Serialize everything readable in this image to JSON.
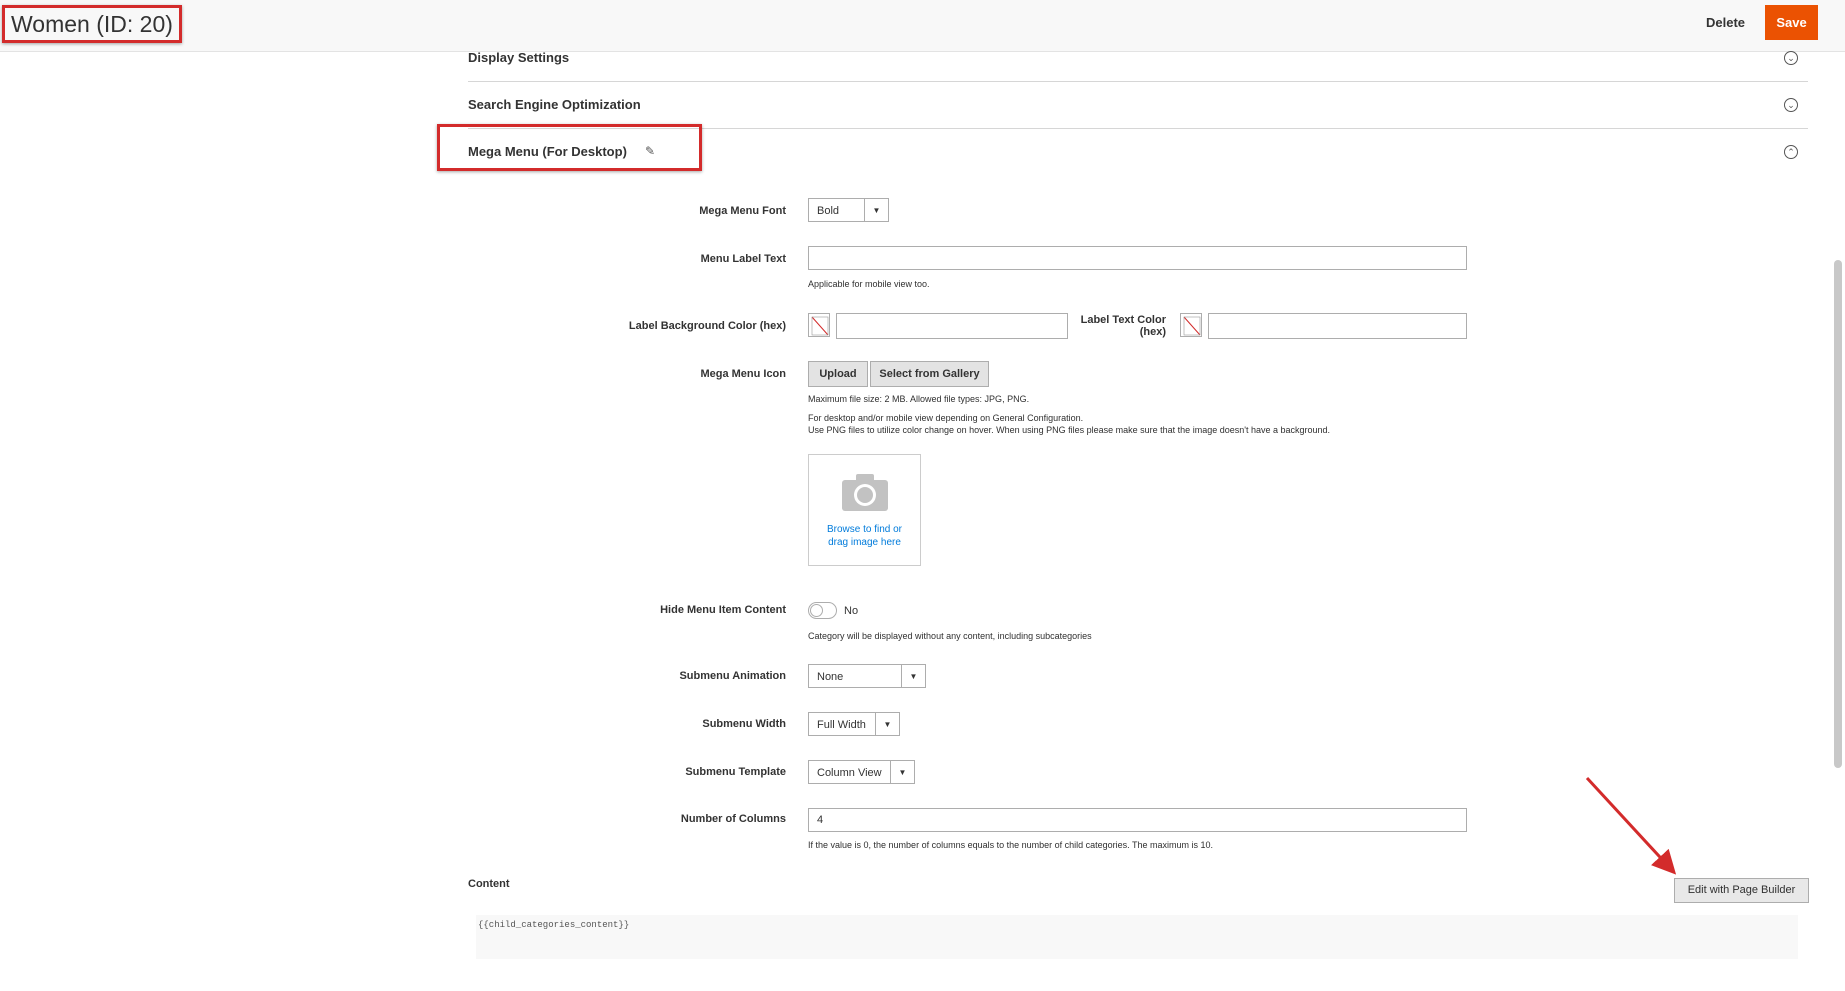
{
  "header": {
    "title": "Women (ID: 20)",
    "delete_label": "Delete",
    "save_label": "Save"
  },
  "sections": {
    "display_settings": "Display Settings",
    "seo": "Search Engine Optimization",
    "mega_menu": "Mega Menu (For Desktop)"
  },
  "form": {
    "font": {
      "label": "Mega Menu Font",
      "value": "Bold"
    },
    "menu_label_text": {
      "label": "Menu Label Text",
      "value": "",
      "note": "Applicable for mobile view too."
    },
    "label_bg_color": {
      "label": "Label Background Color (hex)",
      "value": ""
    },
    "label_text_color": {
      "label_line1": "Label Text Color",
      "label_line2": "(hex)",
      "value": ""
    },
    "icon": {
      "label": "Mega Menu Icon",
      "upload_label": "Upload",
      "gallery_label": "Select from Gallery",
      "note1": "Maximum file size: 2 MB. Allowed file types: JPG, PNG.",
      "note2": "For desktop and/or mobile view depending on General Configuration.",
      "note3": "Use PNG files to utilize color change on hover. When using PNG files please make sure that the image doesn't have a background.",
      "dropzone_line1": "Browse to find or",
      "dropzone_line2": "drag image here"
    },
    "hide_content": {
      "label": "Hide Menu Item Content",
      "state": "No",
      "note": "Category will be displayed without any content, including subcategories"
    },
    "submenu_animation": {
      "label": "Submenu Animation",
      "value": "None"
    },
    "submenu_width": {
      "label": "Submenu Width",
      "value": "Full Width"
    },
    "submenu_template": {
      "label": "Submenu Template",
      "value": "Column View"
    },
    "columns": {
      "label": "Number of Columns",
      "value": "4",
      "note": "If the value is 0, the number of columns equals to the number of child categories. The maximum is 10."
    },
    "content": {
      "label": "Content",
      "edit_button": "Edit with Page Builder",
      "value": "{{child_categories_content}}"
    }
  },
  "colors": {
    "accent": "#eb5202",
    "highlight": "#d32b2b",
    "link": "#007bdb"
  }
}
